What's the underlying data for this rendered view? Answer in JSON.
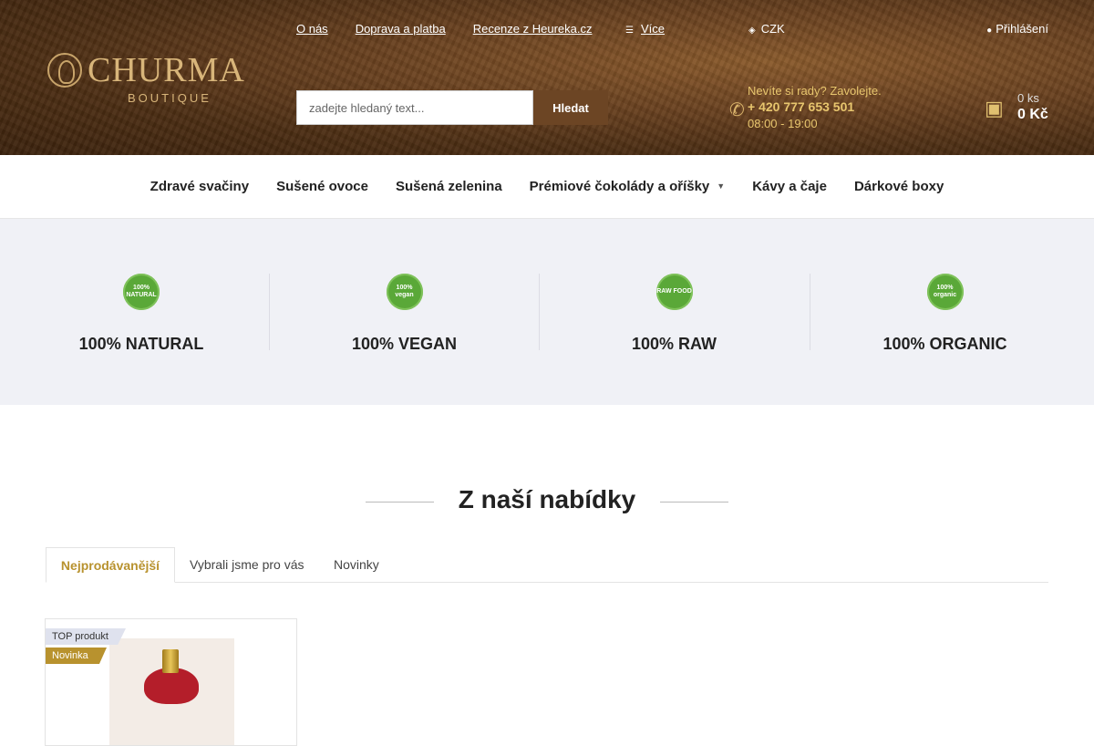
{
  "brand": {
    "name": "CHURMA",
    "subtitle": "BOUTIQUE",
    "logo_icon": "monkey-icon"
  },
  "top_nav": [
    {
      "label": "O nás"
    },
    {
      "label": "Doprava a platba"
    },
    {
      "label": "Recenze z Heureka.cz"
    }
  ],
  "more_menu": {
    "icon": "menu-icon",
    "label": "Více"
  },
  "currency": {
    "icon": "currency-icon",
    "label": "CZK"
  },
  "login": {
    "icon": "user-icon",
    "label": "Přihlášení"
  },
  "search": {
    "placeholder": "zadejte hledaný text...",
    "button": "Hledat"
  },
  "contact": {
    "icon": "phone-icon",
    "prompt": "Nevíte si rady? Zavolejte.",
    "phone": "+ 420 777 653 501",
    "hours": "08:00 - 19:00"
  },
  "cart": {
    "icon": "cart-icon",
    "quantity": "0 ks",
    "total": "0 Kč"
  },
  "categories": [
    {
      "label": "Zdravé svačiny"
    },
    {
      "label": "Sušené ovoce"
    },
    {
      "label": "Sušená zelenina"
    },
    {
      "label": "Prémiové čokolády a oříšky",
      "has_submenu": true
    },
    {
      "label": "Kávy a čaje"
    },
    {
      "label": "Dárkové boxy"
    }
  ],
  "features": [
    {
      "label": "100% NATURAL",
      "badge_text": "100% NATURAL",
      "icon": "natural-badge-icon"
    },
    {
      "label": "100% VEGAN",
      "badge_text": "100% vegan",
      "icon": "vegan-badge-icon"
    },
    {
      "label": "100% RAW",
      "badge_text": "RAW FOOD",
      "icon": "raw-food-badge-icon"
    },
    {
      "label": "100% ORGANIC",
      "badge_text": "100% organic",
      "icon": "organic-badge-icon"
    }
  ],
  "offer": {
    "title": "Z naší nabídky",
    "tabs": [
      {
        "label": "Nejprodávanější",
        "active": true
      },
      {
        "label": "Vybrali jsme pro vás",
        "active": false
      },
      {
        "label": "Novinky",
        "active": false
      }
    ]
  },
  "product_card": {
    "flag_top": "TOP produkt",
    "flag_new": "Novinka"
  },
  "colors": {
    "accent_gold": "#b8922e",
    "header_brown": "#6c4524",
    "badge_green": "#5aa838",
    "feature_bg": "#f0f1f6"
  }
}
